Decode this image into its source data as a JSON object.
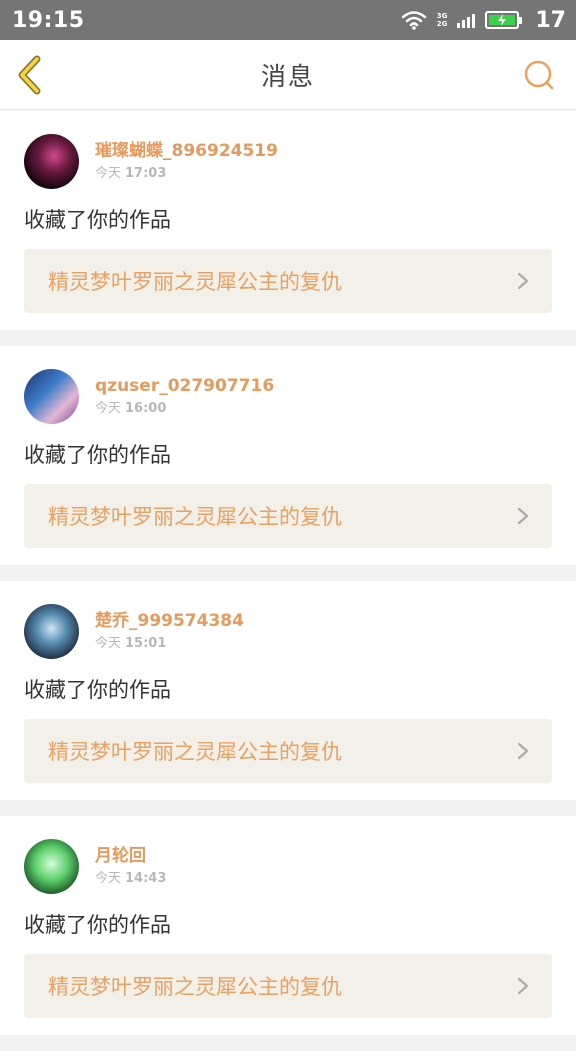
{
  "status_bar": {
    "time": "19:15",
    "network_top": "3G",
    "network_bottom": "2G",
    "battery_level": "17",
    "battery_color": "#3ad14a"
  },
  "header": {
    "title": "消息",
    "accent_color": "#e59a5e"
  },
  "messages": [
    {
      "username": "璀璨蝴蝶_896924519",
      "day": "今天",
      "time": "17:03",
      "action": "收藏了你的作品",
      "work_title": "精灵梦叶罗丽之灵犀公主的复仇"
    },
    {
      "username": "qzuser_027907716",
      "day": "今天",
      "time": "16:00",
      "action": "收藏了你的作品",
      "work_title": "精灵梦叶罗丽之灵犀公主的复仇"
    },
    {
      "username": "楚乔_999574384",
      "day": "今天",
      "time": "15:01",
      "action": "收藏了你的作品",
      "work_title": "精灵梦叶罗丽之灵犀公主的复仇"
    },
    {
      "username": "月轮回",
      "day": "今天",
      "time": "14:43",
      "action": "收藏了你的作品",
      "work_title": "精灵梦叶罗丽之灵犀公主的复仇"
    }
  ]
}
